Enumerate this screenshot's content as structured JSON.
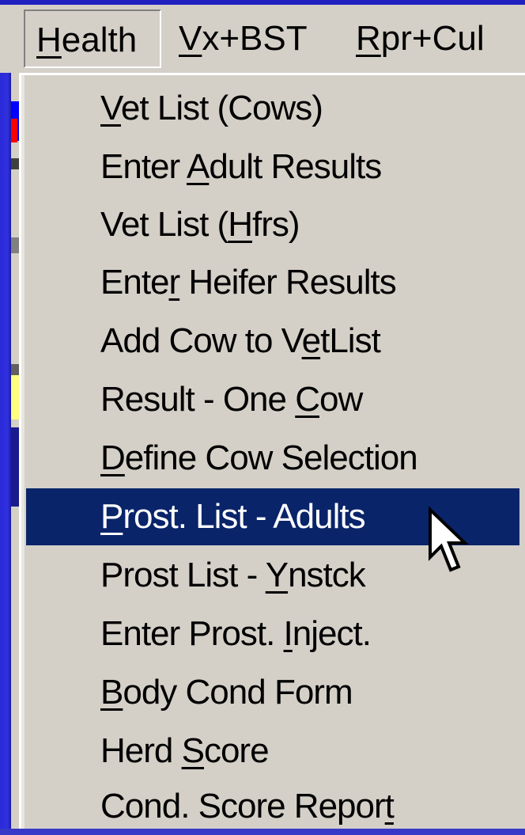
{
  "menubar": {
    "menus": [
      {
        "pre": "",
        "key": "H",
        "post": "ealth",
        "active": true
      },
      {
        "pre": "",
        "key": "V",
        "post": "x+BST",
        "active": false
      },
      {
        "pre": "",
        "key": "R",
        "post": "pr+Cul",
        "active": false
      }
    ]
  },
  "dropdown": {
    "items": [
      {
        "pre": "",
        "key": "V",
        "post": "et List (Cows)",
        "selected": false
      },
      {
        "pre": "Enter ",
        "key": "A",
        "post": "dult Results",
        "selected": false
      },
      {
        "pre": "Vet List (",
        "key": "H",
        "post": "frs)",
        "selected": false
      },
      {
        "pre": "Ente",
        "key": "r",
        "post": " Heifer Results",
        "selected": false
      },
      {
        "pre": "Add Cow to V",
        "key": "e",
        "post": "tList",
        "selected": false
      },
      {
        "pre": "Result - One ",
        "key": "C",
        "post": "ow",
        "selected": false
      },
      {
        "pre": "",
        "key": "D",
        "post": "efine Cow Selection",
        "selected": false
      },
      {
        "pre": "",
        "key": "P",
        "post": "rost. List - Adults",
        "selected": true
      },
      {
        "pre": "Prost List - ",
        "key": "Y",
        "post": "nstck",
        "selected": false
      },
      {
        "pre": "Enter Prost. ",
        "key": "I",
        "post": "nject.",
        "selected": false
      },
      {
        "pre": "",
        "key": "B",
        "post": "ody Cond Form",
        "selected": false
      },
      {
        "pre": "Herd ",
        "key": "S",
        "post": "core",
        "selected": false
      },
      {
        "pre": "Cond. Score Repor",
        "key": "t",
        "post": "",
        "selected": false
      }
    ]
  },
  "colors": {
    "menu_bg": "#d4d0c8",
    "highlight": "#0a246a",
    "highlight_text": "#ffffff",
    "desktop": "#3838c8"
  },
  "cursor": {
    "icon": "arrow-pointer-icon"
  }
}
